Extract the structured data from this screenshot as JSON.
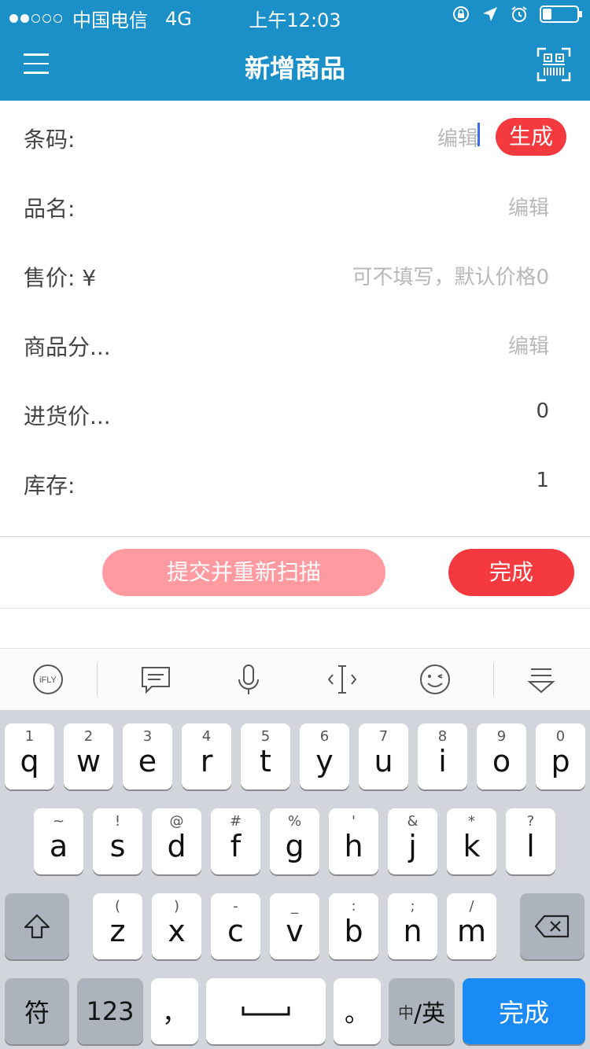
{
  "status_bar": {
    "carrier": "中国电信",
    "network": "4G",
    "time": "上午12:03"
  },
  "nav": {
    "title": "新增商品"
  },
  "form": {
    "rows": [
      {
        "label": "条码:",
        "value": "编辑"
      },
      {
        "label": "品名:",
        "value": "编辑"
      },
      {
        "label": "售价: ¥",
        "value": "可不填写，默认价格0"
      },
      {
        "label": "商品分...",
        "value": "编辑"
      },
      {
        "label": "进货价...",
        "value": "0"
      },
      {
        "label": "库存:",
        "value": "1"
      }
    ],
    "generate_label": "生成"
  },
  "actions": {
    "resubmit_label": "提交并重新扫描",
    "done_label": "完成"
  },
  "ime_toolbar": {
    "brand": "iFLY"
  },
  "keyboard": {
    "row1": [
      {
        "sub": "1",
        "main": "q"
      },
      {
        "sub": "2",
        "main": "w"
      },
      {
        "sub": "3",
        "main": "e"
      },
      {
        "sub": "4",
        "main": "r"
      },
      {
        "sub": "5",
        "main": "t"
      },
      {
        "sub": "6",
        "main": "y"
      },
      {
        "sub": "7",
        "main": "u"
      },
      {
        "sub": "8",
        "main": "i"
      },
      {
        "sub": "9",
        "main": "o"
      },
      {
        "sub": "0",
        "main": "p"
      }
    ],
    "row2": [
      {
        "sub": "~",
        "main": "a"
      },
      {
        "sub": "!",
        "main": "s"
      },
      {
        "sub": "@",
        "main": "d"
      },
      {
        "sub": "#",
        "main": "f"
      },
      {
        "sub": "%",
        "main": "g"
      },
      {
        "sub": "'",
        "main": "h"
      },
      {
        "sub": "&",
        "main": "j"
      },
      {
        "sub": "*",
        "main": "k"
      },
      {
        "sub": "?",
        "main": "l"
      }
    ],
    "row3": [
      {
        "sub": "(",
        "main": "z"
      },
      {
        "sub": ")",
        "main": "x"
      },
      {
        "sub": "-",
        "main": "c"
      },
      {
        "sub": "_",
        "main": "v"
      },
      {
        "sub": ":",
        "main": "b"
      },
      {
        "sub": ";",
        "main": "n"
      },
      {
        "sub": "/",
        "main": "m"
      }
    ],
    "symbols_label": "符",
    "numbers_label": "123",
    "comma_label": "，",
    "period_label": "。",
    "lang_small": "中",
    "lang_big": "/英",
    "done_label": "完成"
  }
}
